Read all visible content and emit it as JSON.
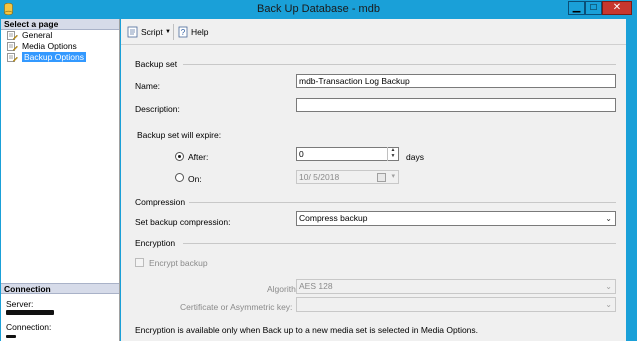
{
  "window": {
    "title": "Back Up Database - mdb",
    "minimize_glyph": "▁",
    "maximize_glyph": "□",
    "close_glyph": "✕"
  },
  "left_pane": {
    "header": "Select a page",
    "pages": [
      {
        "label": "General",
        "icon": "page-wrench-icon",
        "selected": false
      },
      {
        "label": "Media Options",
        "icon": "page-wrench-icon",
        "selected": false
      },
      {
        "label": "Backup Options",
        "icon": "page-wrench-icon",
        "selected": true
      }
    ],
    "connection": {
      "header": "Connection",
      "server_label": "Server:",
      "connection_label": "Connection:"
    }
  },
  "toolbar": {
    "script_label": "Script",
    "script_icon": "script-icon",
    "script_dropdown_glyph": "▼",
    "help_label": "Help",
    "help_icon": "help-icon"
  },
  "backup_set": {
    "group_title": "Backup set",
    "name_label": "Name:",
    "name_value": "mdb-Transaction Log Backup",
    "description_label": "Description:",
    "description_value": "",
    "expire_label": "Backup set will expire:",
    "after_label": "After:",
    "after_value": "0",
    "after_unit": "days",
    "after_checked": true,
    "on_label": "On:",
    "on_value": "10/ 5/2018",
    "on_checked": false
  },
  "compression": {
    "group_title": "Compression",
    "label": "Set backup compression:",
    "value": "Compress backup"
  },
  "encryption": {
    "group_title": "Encryption",
    "encrypt_label": "Encrypt backup",
    "encrypt_checked": false,
    "algorithm_label": "Algorithm:",
    "algorithm_value": "AES 128",
    "cert_label": "Certificate or Asymmetric key:",
    "cert_value": "",
    "note": "Encryption is available only when Back up to a new media set is selected in Media Options."
  },
  "colors": {
    "title_bar": "#1aa0d8",
    "selection": "#3399ff",
    "close_button": "#c7372f"
  }
}
